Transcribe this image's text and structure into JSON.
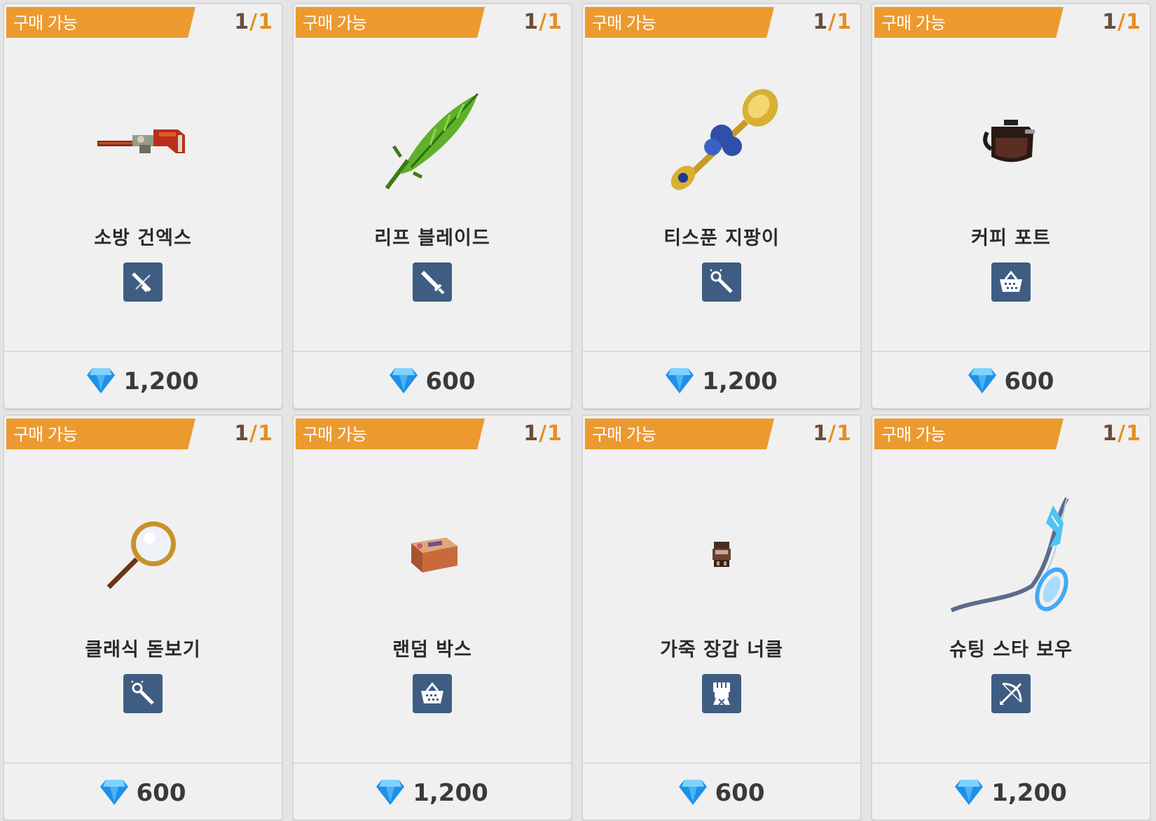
{
  "cards": [
    {
      "badge": "구매 가능",
      "stock_current": "1",
      "stock_sep": "/",
      "stock_max": "1",
      "name": "소방 건엑스",
      "category_icon": "gun-icon",
      "item_icon": "fire-gunaxe-icon",
      "price": "1,200"
    },
    {
      "badge": "구매 가능",
      "stock_current": "1",
      "stock_sep": "/",
      "stock_max": "1",
      "name": "리프 블레이드",
      "category_icon": "sword-icon",
      "item_icon": "leaf-blade-icon",
      "price": "600"
    },
    {
      "badge": "구매 가능",
      "stock_current": "1",
      "stock_sep": "/",
      "stock_max": "1",
      "name": "티스푼 지팡이",
      "category_icon": "staff-icon",
      "item_icon": "teaspoon-staff-icon",
      "price": "1,200"
    },
    {
      "badge": "구매 가능",
      "stock_current": "1",
      "stock_sep": "/",
      "stock_max": "1",
      "name": "커피 포트",
      "category_icon": "basket-icon",
      "item_icon": "coffee-pot-icon",
      "price": "600"
    },
    {
      "badge": "구매 가능",
      "stock_current": "1",
      "stock_sep": "/",
      "stock_max": "1",
      "name": "클래식 돋보기",
      "category_icon": "staff-icon",
      "item_icon": "magnifying-glass-icon",
      "price": "600"
    },
    {
      "badge": "구매 가능",
      "stock_current": "1",
      "stock_sep": "/",
      "stock_max": "1",
      "name": "랜덤 박스",
      "category_icon": "basket-icon",
      "item_icon": "random-box-icon",
      "price": "1,200"
    },
    {
      "badge": "구매 가능",
      "stock_current": "1",
      "stock_sep": "/",
      "stock_max": "1",
      "name": "가죽 장갑 너클",
      "category_icon": "fist-icon",
      "item_icon": "leather-knuckle-icon",
      "price": "600"
    },
    {
      "badge": "구매 가능",
      "stock_current": "1",
      "stock_sep": "/",
      "stock_max": "1",
      "name": "슈팅 스타 보우",
      "category_icon": "bow-icon",
      "item_icon": "shooting-star-bow-icon",
      "price": "1,200"
    }
  ],
  "currency_icon": "diamond-gem-icon",
  "colors": {
    "badge": "#ec9a30",
    "category_bg": "#3f5d82",
    "gem": "#2fa8f0"
  }
}
